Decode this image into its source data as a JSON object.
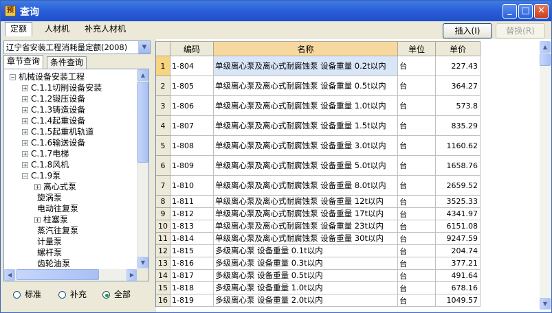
{
  "window": {
    "title": "查询"
  },
  "top_tabs": [
    "定额",
    "人材机",
    "补充人材机"
  ],
  "buttons": {
    "insert": "插入(I)",
    "replace": "替换(R)"
  },
  "quota_selector": {
    "value": "辽宁省安装工程消耗量定额(2008)"
  },
  "sub_tabs": [
    "章节查询",
    "条件查询"
  ],
  "tree": [
    {
      "label": "机械设备安装工程",
      "level": 0,
      "toggle": "−"
    },
    {
      "label": "C.1.1切削设备安装",
      "level": 1,
      "toggle": "+"
    },
    {
      "label": "C.1.2锻压设备",
      "level": 1,
      "toggle": "+"
    },
    {
      "label": "C.1.3铸造设备",
      "level": 1,
      "toggle": "+"
    },
    {
      "label": "C.1.4起重设备",
      "level": 1,
      "toggle": "+"
    },
    {
      "label": "C.1.5起重机轨道",
      "level": 1,
      "toggle": "+"
    },
    {
      "label": "C.1.6输送设备",
      "level": 1,
      "toggle": "+"
    },
    {
      "label": "C.1.7电梯",
      "level": 1,
      "toggle": "+"
    },
    {
      "label": "C.1.8风机",
      "level": 1,
      "toggle": "+"
    },
    {
      "label": "C.1.9泵",
      "level": 1,
      "toggle": "−"
    },
    {
      "label": "离心式泵",
      "level": 2,
      "toggle": "+"
    },
    {
      "label": "旋涡泵",
      "level": 2,
      "toggle": ""
    },
    {
      "label": "电动往复泵",
      "level": 2,
      "toggle": ""
    },
    {
      "label": "柱塞泵",
      "level": 2,
      "toggle": "+"
    },
    {
      "label": "蒸汽往复泵",
      "level": 2,
      "toggle": ""
    },
    {
      "label": "计量泵",
      "level": 2,
      "toggle": ""
    },
    {
      "label": "螺杆泵",
      "level": 2,
      "toggle": ""
    },
    {
      "label": "齿轮油泵",
      "level": 2,
      "toggle": ""
    }
  ],
  "filters": {
    "standard": "标准",
    "supplement": "补充",
    "all": "全部",
    "selected": "all"
  },
  "grid": {
    "headers": {
      "code": "编码",
      "name": "名称",
      "unit": "单位",
      "price": "单价"
    },
    "rows": [
      {
        "n": "1",
        "code": "1-804",
        "name": "单级离心泵及离心式耐腐蚀泵 设备重量 0.2t以内",
        "unit": "台",
        "price": "227.43"
      },
      {
        "n": "2",
        "code": "1-805",
        "name": "单级离心泵及离心式耐腐蚀泵 设备重量 0.5t以内",
        "unit": "台",
        "price": "364.27"
      },
      {
        "n": "3",
        "code": "1-806",
        "name": "单级离心泵及离心式耐腐蚀泵 设备重量 1.0t以内",
        "unit": "台",
        "price": "573.8"
      },
      {
        "n": "4",
        "code": "1-807",
        "name": "单级离心泵及离心式耐腐蚀泵 设备重量 1.5t以内",
        "unit": "台",
        "price": "835.29"
      },
      {
        "n": "5",
        "code": "1-808",
        "name": "单级离心泵及离心式耐腐蚀泵 设备重量 3.0t以内",
        "unit": "台",
        "price": "1160.62"
      },
      {
        "n": "6",
        "code": "1-809",
        "name": "单级离心泵及离心式耐腐蚀泵 设备重量 5.0t以内",
        "unit": "台",
        "price": "1658.76"
      },
      {
        "n": "7",
        "code": "1-810",
        "name": "单级离心泵及离心式耐腐蚀泵 设备重量 8.0t以内",
        "unit": "台",
        "price": "2659.52"
      },
      {
        "n": "8",
        "code": "1-811",
        "name": "单级离心泵及离心式耐腐蚀泵 设备重量 12t以内",
        "unit": "台",
        "price": "3525.33"
      },
      {
        "n": "9",
        "code": "1-812",
        "name": "单级离心泵及离心式耐腐蚀泵 设备重量 17t以内",
        "unit": "台",
        "price": "4341.97"
      },
      {
        "n": "10",
        "code": "1-813",
        "name": "单级离心泵及离心式耐腐蚀泵 设备重量 23t以内",
        "unit": "台",
        "price": "6151.08"
      },
      {
        "n": "11",
        "code": "1-814",
        "name": "单级离心泵及离心式耐腐蚀泵 设备重量 30t以内",
        "unit": "台",
        "price": "9247.59"
      },
      {
        "n": "12",
        "code": "1-815",
        "name": "多级离心泵 设备重量 0.1t以内",
        "unit": "台",
        "price": "204.74"
      },
      {
        "n": "13",
        "code": "1-816",
        "name": "多级离心泵 设备重量 0.3t以内",
        "unit": "台",
        "price": "377.21"
      },
      {
        "n": "14",
        "code": "1-817",
        "name": "多级离心泵 设备重量 0.5t以内",
        "unit": "台",
        "price": "491.64"
      },
      {
        "n": "15",
        "code": "1-818",
        "name": "多级离心泵 设备重量 1.0t以内",
        "unit": "台",
        "price": "678.16"
      },
      {
        "n": "16",
        "code": "1-819",
        "name": "多级离心泵 设备重量 2.0t以内",
        "unit": "台",
        "price": "1049.57"
      }
    ]
  }
}
